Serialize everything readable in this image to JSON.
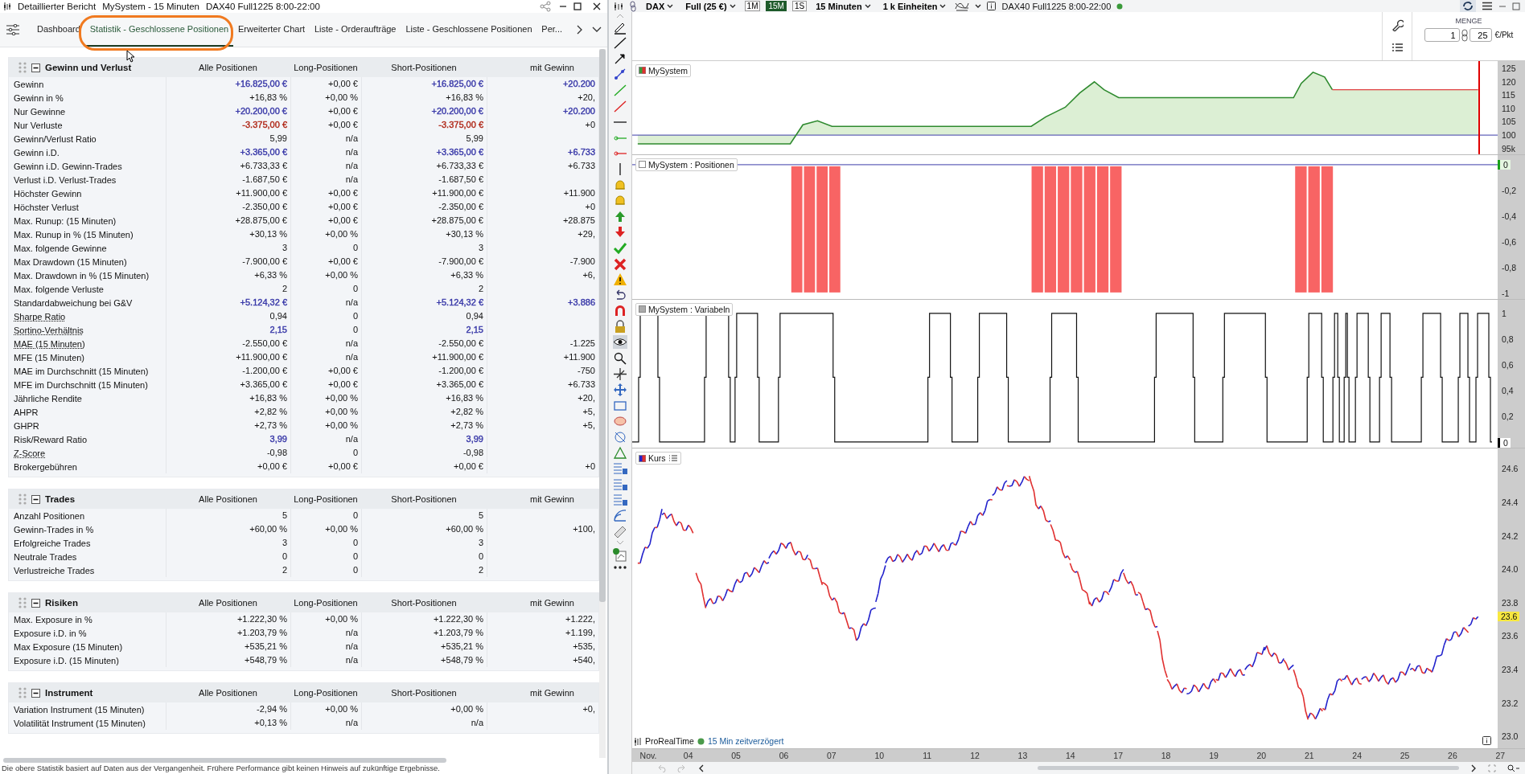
{
  "report_window": {
    "title_parts": [
      "Detaillierter Bericht",
      "MySystem - 15 Minuten",
      "DAX40 Full1225 8:00-22:00"
    ]
  },
  "tabs": [
    {
      "label": "Dashboard",
      "selected": false
    },
    {
      "label": "Statistik - Geschlossene Positionen",
      "selected": true
    },
    {
      "label": "Erweiterter Chart",
      "selected": false
    },
    {
      "label": "Liste - Orderaufträge",
      "selected": false
    },
    {
      "label": "Liste - Geschlossene Positionen",
      "selected": false
    },
    {
      "label": "Per...",
      "selected": false
    }
  ],
  "sections": [
    {
      "title": "Gewinn und Verlust",
      "expanded": true,
      "columns": [
        "Alle Positionen",
        "Long-Positionen",
        "Short-Positionen",
        "mit Gewinn"
      ],
      "rows": [
        {
          "label": "Gewinn",
          "underlined": false,
          "cells": [
            {
              "text": "+16.825,00 €",
              "color": "#3838a8"
            },
            "+0,00 €",
            {
              "text": "+16.825,00 €",
              "color": "#3838a8"
            },
            {
              "text": "+20.200",
              "color": "#3838a8"
            }
          ]
        },
        {
          "label": "Gewinn in %",
          "underlined": false,
          "cells": [
            "+16,83 %",
            "+0,00 %",
            "+16,83 %",
            "+20,"
          ]
        },
        {
          "label": "Nur Gewinne",
          "underlined": false,
          "cells": [
            {
              "text": "+20.200,00 €",
              "color": "#3838a8"
            },
            "+0,00 €",
            {
              "text": "+20.200,00 €",
              "color": "#3838a8"
            },
            {
              "text": "+20.200",
              "color": "#3838a8"
            }
          ]
        },
        {
          "label": "Nur Verluste",
          "underlined": false,
          "cells": [
            {
              "text": "-3.375,00 €",
              "color": "#b02818"
            },
            "+0,00 €",
            {
              "text": "-3.375,00 €",
              "color": "#b02818"
            },
            "+0"
          ]
        },
        {
          "label": "Gewinn/Verlust Ratio",
          "underlined": false,
          "cells": [
            "5,99",
            "n/a",
            "5,99",
            ""
          ]
        },
        {
          "label": "Gewinn i.D.",
          "underlined": false,
          "cells": [
            {
              "text": "+3.365,00 €",
              "color": "#3838a8"
            },
            "n/a",
            {
              "text": "+3.365,00 €",
              "color": "#3838a8"
            },
            {
              "text": "+6.733",
              "color": "#3838a8"
            }
          ]
        },
        {
          "label": "Gewinn i.D. Gewinn-Trades",
          "underlined": false,
          "cells": [
            "+6.733,33 €",
            "n/a",
            "+6.733,33 €",
            "+6.733"
          ]
        },
        {
          "label": "Verlust i.D. Verlust-Trades",
          "underlined": false,
          "cells": [
            "-1.687,50 €",
            "n/a",
            "-1.687,50 €",
            ""
          ]
        },
        {
          "label": "Höchster Gewinn",
          "underlined": false,
          "cells": [
            "+11.900,00 €",
            "+0,00 €",
            "+11.900,00 €",
            "+11.900"
          ]
        },
        {
          "label": "Höchster Verlust",
          "underlined": false,
          "cells": [
            "-2.350,00 €",
            "+0,00 €",
            "-2.350,00 €",
            "+0"
          ]
        },
        {
          "label": "Max. Runup: (15 Minuten)",
          "underlined": false,
          "cells": [
            "+28.875,00 €",
            "+0,00 €",
            "+28.875,00 €",
            "+28.875"
          ]
        },
        {
          "label": "Max. Runup in % (15 Minuten)",
          "underlined": false,
          "cells": [
            "+30,13 %",
            "+0,00 %",
            "+30,13 %",
            "+29,"
          ]
        },
        {
          "label": "Max. folgende Gewinne",
          "underlined": false,
          "cells": [
            "3",
            "0",
            "3",
            ""
          ]
        },
        {
          "label": "Max Drawdown (15 Minuten)",
          "underlined": false,
          "cells": [
            "-7.900,00 €",
            "+0,00 €",
            "-7.900,00 €",
            "-7.900"
          ]
        },
        {
          "label": "Max. Drawdown in % (15 Minuten)",
          "underlined": false,
          "cells": [
            "+6,33 %",
            "+0,00 %",
            "+6,33 %",
            "+6,"
          ]
        },
        {
          "label": "Max. folgende Verluste",
          "underlined": false,
          "cells": [
            "2",
            "0",
            "2",
            ""
          ]
        },
        {
          "label": "Standardabweichung bei G&V",
          "underlined": false,
          "cells": [
            {
              "text": "+5.124,32 €",
              "color": "#3838a8"
            },
            "n/a",
            {
              "text": "+5.124,32 €",
              "color": "#3838a8"
            },
            {
              "text": "+3.886",
              "color": "#3838a8"
            }
          ]
        },
        {
          "label": "Sharpe Ratio",
          "underlined": true,
          "cells": [
            "0,94",
            "0",
            "0,94",
            ""
          ]
        },
        {
          "label": "Sortino-Verhältnis",
          "underlined": true,
          "cells": [
            {
              "text": "2,15",
              "color": "#3838a8"
            },
            "0",
            {
              "text": "2,15",
              "color": "#3838a8"
            },
            ""
          ]
        },
        {
          "label": "MAE (15 Minuten)",
          "underlined": true,
          "cells": [
            "-2.550,00 €",
            "n/a",
            "-2.550,00 €",
            "-1.225"
          ]
        },
        {
          "label": "MFE (15 Minuten)",
          "underlined": false,
          "cells": [
            "+11.900,00 €",
            "n/a",
            "+11.900,00 €",
            "+11.900"
          ]
        },
        {
          "label": "MAE im Durchschnitt (15 Minuten)",
          "underlined": false,
          "cells": [
            "-1.200,00 €",
            "+0,00 €",
            "-1.200,00 €",
            "-750"
          ]
        },
        {
          "label": "MFE im Durchschnitt (15 Minuten)",
          "underlined": false,
          "cells": [
            "+3.365,00 €",
            "+0,00 €",
            "+3.365,00 €",
            "+6.733"
          ]
        },
        {
          "label": "Jährliche Rendite",
          "underlined": false,
          "cells": [
            "+16,83 %",
            "+0,00 %",
            "+16,83 %",
            "+20,"
          ]
        },
        {
          "label": "AHPR",
          "underlined": false,
          "cells": [
            "+2,82 %",
            "+0,00 %",
            "+2,82 %",
            "+5,"
          ]
        },
        {
          "label": "GHPR",
          "underlined": false,
          "cells": [
            "+2,73 %",
            "+0,00 %",
            "+2,73 %",
            "+5,"
          ]
        },
        {
          "label": "Risk/Reward Ratio",
          "underlined": false,
          "cells": [
            {
              "text": "3,99",
              "color": "#3838a8"
            },
            "n/a",
            {
              "text": "3,99",
              "color": "#3838a8"
            },
            ""
          ]
        },
        {
          "label": "Z-Score",
          "underlined": true,
          "cells": [
            "-0,98",
            "0",
            "-0,98",
            ""
          ]
        },
        {
          "label": "Brokergebühren",
          "underlined": false,
          "cells": [
            "+0,00 €",
            "+0,00 €",
            "+0,00 €",
            "+0"
          ]
        }
      ]
    },
    {
      "title": "Trades",
      "expanded": true,
      "columns": [
        "Alle Positionen",
        "Long-Positionen",
        "Short-Positionen",
        "mit Gewinn"
      ],
      "rows": [
        {
          "label": "Anzahl Positionen",
          "underlined": false,
          "cells": [
            "5",
            "0",
            "5",
            ""
          ]
        },
        {
          "label": "Gewinn-Trades in %",
          "underlined": false,
          "cells": [
            "+60,00 %",
            "+0,00 %",
            "+60,00 %",
            "+100,"
          ]
        },
        {
          "label": "Erfolgreiche Trades",
          "underlined": false,
          "cells": [
            "3",
            "0",
            "3",
            ""
          ]
        },
        {
          "label": "Neutrale Trades",
          "underlined": false,
          "cells": [
            "0",
            "0",
            "0",
            ""
          ]
        },
        {
          "label": "Verlustreiche Trades",
          "underlined": false,
          "cells": [
            "2",
            "0",
            "2",
            ""
          ]
        }
      ]
    },
    {
      "title": "Risiken",
      "expanded": true,
      "columns": [
        "Alle Positionen",
        "Long-Positionen",
        "Short-Positionen",
        "mit Gewinn"
      ],
      "rows": [
        {
          "label": "Max. Exposure in %",
          "underlined": false,
          "cells": [
            "+1.222,30 %",
            "+0,00 %",
            "+1.222,30 %",
            "+1.222,"
          ]
        },
        {
          "label": "Exposure i.D. in %",
          "underlined": false,
          "cells": [
            "+1.203,79 %",
            "n/a",
            "+1.203,79 %",
            "+1.199,"
          ]
        },
        {
          "label": "Max Exposure (15 Minuten)",
          "underlined": false,
          "cells": [
            "+535,21 %",
            "n/a",
            "+535,21 %",
            "+535,"
          ]
        },
        {
          "label": "Exposure i.D. (15 Minuten)",
          "underlined": false,
          "cells": [
            "+548,79 %",
            "n/a",
            "+548,79 %",
            "+540,"
          ]
        }
      ]
    },
    {
      "title": "Instrument",
      "expanded": true,
      "columns": [
        "Alle Positionen",
        "Long-Positionen",
        "Short-Positionen",
        "mit Gewinn"
      ],
      "rows": [
        {
          "label": "Variation Instrument (15 Minuten)",
          "underlined": false,
          "cells": [
            "-2,94 %",
            "+0,00 %",
            "+0,00 %",
            "+0,"
          ]
        },
        {
          "label": "Volatilität Instrument (15 Minuten)",
          "underlined": false,
          "cells": [
            "+0,13 %",
            "n/a",
            "n/a",
            ""
          ]
        }
      ]
    }
  ],
  "footer_note": "Die obere Statistik basiert auf Daten aus der Vergangenheit. Frühere Performance gibt keinen Hinweis auf zukünftige Ergebnisse.",
  "chart_window": {
    "instrument": "DAX",
    "contract": "Full (25 €)",
    "periods": [
      {
        "label": "1M",
        "selected": false
      },
      {
        "label": "15M",
        "selected": true
      },
      {
        "label": "1S",
        "selected": false
      }
    ],
    "timeframe": "15 Minuten",
    "units": "1 k Einheiten",
    "title": "DAX40 Full1225 8:00-22:00",
    "quantity": {
      "label": "MENGE",
      "value": "1",
      "multiplier": "25",
      "unit": "€/Pkt"
    }
  },
  "panels": [
    {
      "kind": "equity",
      "title": "MySystem",
      "ticks": [
        "125",
        "120",
        "115",
        "110",
        "105",
        "100",
        "95k"
      ]
    },
    {
      "kind": "positions",
      "title": "MySystem : Positionen",
      "value_label": "0",
      "ticks": [
        "-0,2",
        "-0,4",
        "-0,6",
        "-0,8",
        "-1"
      ]
    },
    {
      "kind": "variables",
      "title": "MySystem : Variabeln",
      "value_label": "0",
      "ticks": [
        "1",
        "0,8",
        "0,6",
        "0,4",
        "0,2"
      ]
    },
    {
      "kind": "price",
      "title": "Kurs",
      "value_label": "23.6",
      "ticks": [
        "24.6",
        "24.4",
        "24.2",
        "24.0",
        "23.8",
        "23.6",
        "23.4",
        "23.2",
        "23.0"
      ]
    }
  ],
  "source": {
    "name": "ProRealTime",
    "delay": "15 Min zeitverzögert"
  },
  "x_axis": [
    "Nov.",
    "04",
    "05",
    "06",
    "07",
    "10",
    "11",
    "12",
    "13",
    "14",
    "17",
    "18",
    "19",
    "20",
    "21",
    "24",
    "25",
    "26",
    "27"
  ]
}
